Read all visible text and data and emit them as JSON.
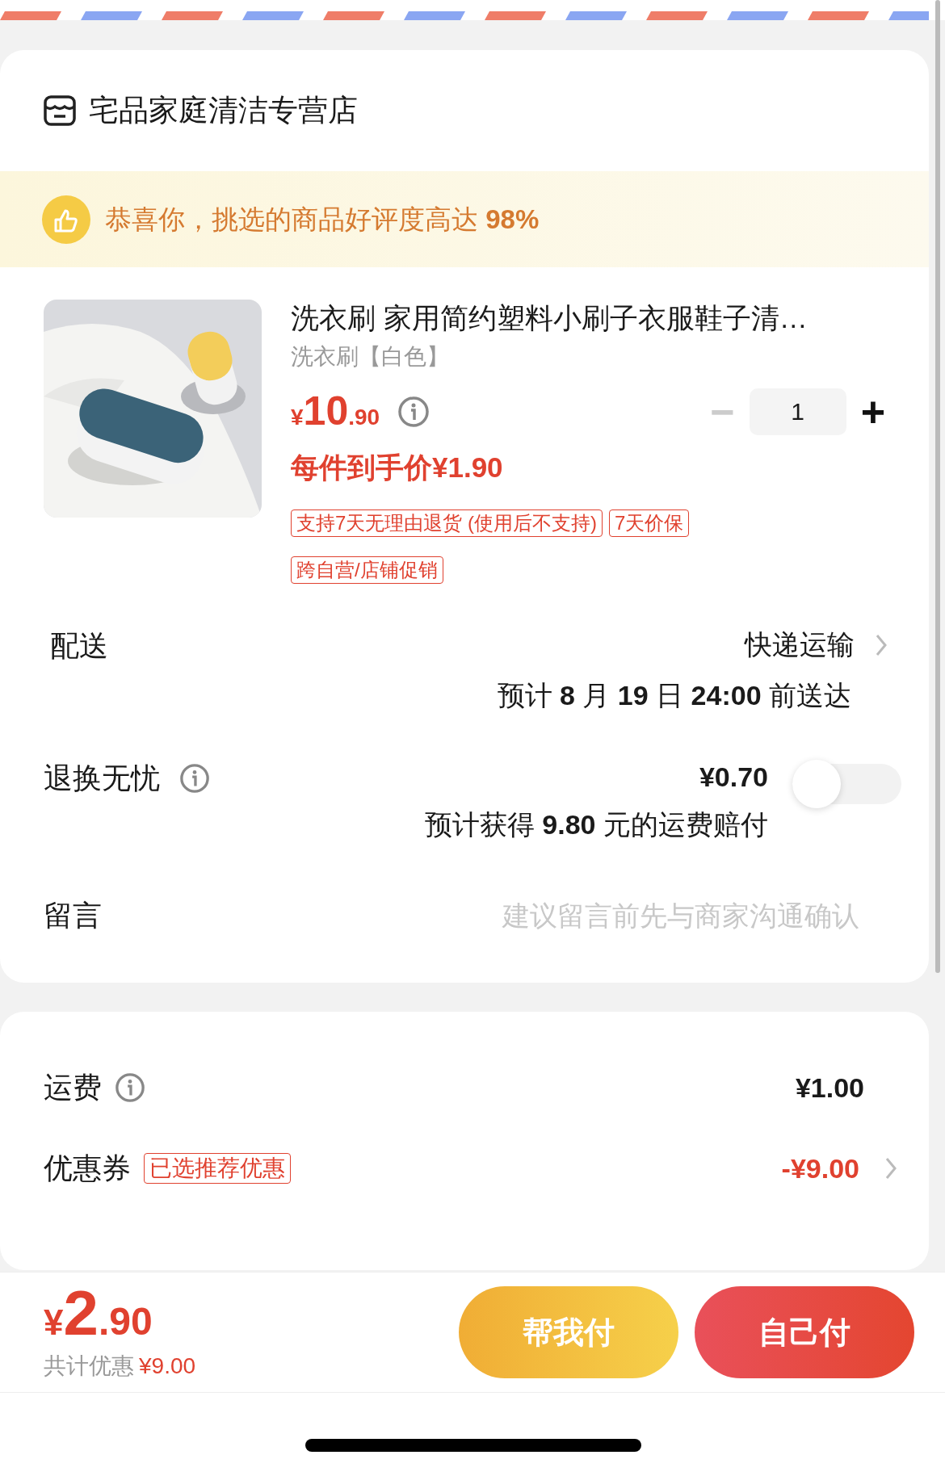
{
  "store": {
    "name": "宅品家庭清洁专营店"
  },
  "banner": {
    "text": "恭喜你，挑选的商品好评度高达 **98%**"
  },
  "product": {
    "kind": "picture",
    "title": "洗衣刷 家用简约塑料小刷子衣服鞋子清…",
    "variant": "洗衣刷【白色】",
    "price_symbol": "¥",
    "price_int": "10",
    "price_dec": ".90",
    "quantity": "1",
    "minus": "−",
    "plus": "+",
    "minus_disabled": true,
    "unit_price": "每件到手价¥1.90",
    "tags": [
      [
        "支持7天无理由退货 (使用后不支持)",
        "7天价保"
      ],
      [
        "跨自营/店铺促销"
      ]
    ]
  },
  "delivery": {
    "label": "配送",
    "method": "快递运输",
    "eta": "预计 **8** 月 **19** 日 **24:00** 前送达"
  },
  "protection": {
    "label": "退换无忧",
    "price": "¥0.70",
    "note": "预计获得 **9.80** 元的运费赔付",
    "on": false
  },
  "message": {
    "label": "留言",
    "placeholder": "建议留言前先与商家沟通确认"
  },
  "fees": [
    {
      "kind": "info",
      "label": "运费",
      "value": "¥1.00"
    },
    {
      "kind": "coupon",
      "label": "优惠券",
      "tag": "已选推荐优惠",
      "value": "-¥9.00"
    }
  ],
  "footer": {
    "symbol": "¥",
    "total_int": "2",
    "total_dec": ".90",
    "saving_label": "共计优惠",
    "saving_value": "¥9.00",
    "buttons": [
      {
        "kind": "friend",
        "label": "帮我付"
      },
      {
        "kind": "self",
        "label": "自己付"
      }
    ]
  }
}
